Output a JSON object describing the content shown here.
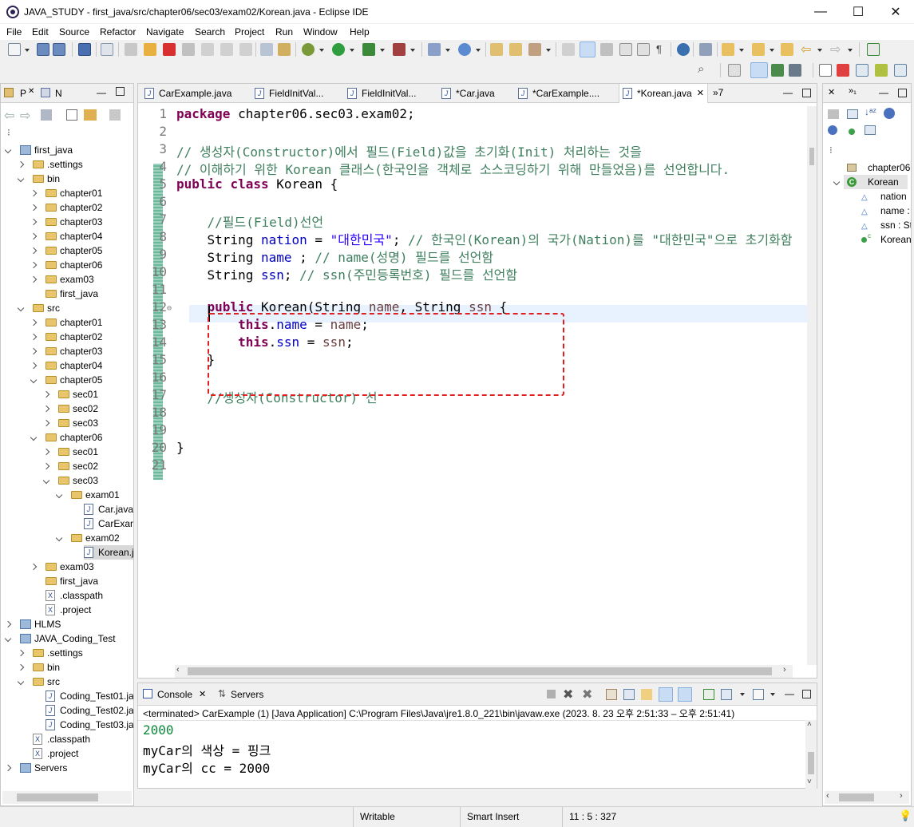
{
  "window": {
    "title": "JAVA_STUDY - first_java/src/chapter06/sec03/exam02/Korean.java - Eclipse IDE",
    "minimize": "—",
    "maximize": "☐",
    "close": "✕"
  },
  "menu": [
    "File",
    "Edit",
    "Source",
    "Refactor",
    "Navigate",
    "Search",
    "Project",
    "Run",
    "Window",
    "Help"
  ],
  "package_explorer": {
    "tab1": "P",
    "tab2": "N",
    "tree": [
      {
        "label": "first_java",
        "level": 0,
        "kind": "project",
        "open": true
      },
      {
        "label": ".settings",
        "level": 1,
        "kind": "folder",
        "open": false
      },
      {
        "label": "bin",
        "level": 1,
        "kind": "folder",
        "open": true
      },
      {
        "label": "chapter01",
        "level": 2,
        "kind": "folder",
        "open": false
      },
      {
        "label": "chapter02",
        "level": 2,
        "kind": "folder",
        "open": false
      },
      {
        "label": "chapter03",
        "level": 2,
        "kind": "folder",
        "open": false
      },
      {
        "label": "chapter04",
        "level": 2,
        "kind": "folder",
        "open": false
      },
      {
        "label": "chapter05",
        "level": 2,
        "kind": "folder",
        "open": false
      },
      {
        "label": "chapter06",
        "level": 2,
        "kind": "folder",
        "open": false
      },
      {
        "label": "exam03",
        "level": 2,
        "kind": "folder",
        "open": false
      },
      {
        "label": "first_java",
        "level": 2,
        "kind": "folder",
        "open": null
      },
      {
        "label": "src",
        "level": 1,
        "kind": "folder",
        "open": true
      },
      {
        "label": "chapter01",
        "level": 2,
        "kind": "folder",
        "open": false
      },
      {
        "label": "chapter02",
        "level": 2,
        "kind": "folder",
        "open": false
      },
      {
        "label": "chapter03",
        "level": 2,
        "kind": "folder",
        "open": false
      },
      {
        "label": "chapter04",
        "level": 2,
        "kind": "folder",
        "open": false
      },
      {
        "label": "chapter05",
        "level": 2,
        "kind": "folder",
        "open": true
      },
      {
        "label": "sec01",
        "level": 3,
        "kind": "folder",
        "open": false
      },
      {
        "label": "sec02",
        "level": 3,
        "kind": "folder",
        "open": false
      },
      {
        "label": "sec03",
        "level": 3,
        "kind": "folder",
        "open": false
      },
      {
        "label": "chapter06",
        "level": 2,
        "kind": "folder",
        "open": true
      },
      {
        "label": "sec01",
        "level": 3,
        "kind": "folder",
        "open": false
      },
      {
        "label": "sec02",
        "level": 3,
        "kind": "folder",
        "open": false
      },
      {
        "label": "sec03",
        "level": 3,
        "kind": "folder",
        "open": true
      },
      {
        "label": "exam01",
        "level": 4,
        "kind": "folder",
        "open": true
      },
      {
        "label": "Car.java",
        "level": 5,
        "kind": "java",
        "open": null
      },
      {
        "label": "CarExan",
        "level": 5,
        "kind": "java",
        "open": null
      },
      {
        "label": "exam02",
        "level": 4,
        "kind": "folder",
        "open": true
      },
      {
        "label": "Korean.j",
        "level": 5,
        "kind": "java",
        "open": null,
        "selected": true
      },
      {
        "label": "exam03",
        "level": 2,
        "kind": "folder",
        "open": false
      },
      {
        "label": "first_java",
        "level": 2,
        "kind": "folder",
        "open": null
      },
      {
        "label": ".classpath",
        "level": 2,
        "kind": "xml",
        "open": null
      },
      {
        "label": ".project",
        "level": 2,
        "kind": "xml",
        "open": null
      },
      {
        "label": "HLMS",
        "level": 0,
        "kind": "project",
        "open": false
      },
      {
        "label": "JAVA_Coding_Test",
        "level": 0,
        "kind": "project",
        "open": true
      },
      {
        "label": ".settings",
        "level": 1,
        "kind": "folder",
        "open": false
      },
      {
        "label": "bin",
        "level": 1,
        "kind": "folder",
        "open": false
      },
      {
        "label": "src",
        "level": 1,
        "kind": "folder",
        "open": true
      },
      {
        "label": "Coding_Test01.ja",
        "level": 2,
        "kind": "java",
        "open": null
      },
      {
        "label": "Coding_Test02.ja",
        "level": 2,
        "kind": "java",
        "open": null
      },
      {
        "label": "Coding_Test03.ja",
        "level": 2,
        "kind": "java",
        "open": null
      },
      {
        "label": ".classpath",
        "level": 1,
        "kind": "xml",
        "open": null
      },
      {
        "label": ".project",
        "level": 1,
        "kind": "xml",
        "open": null
      },
      {
        "label": "Servers",
        "level": 0,
        "kind": "project",
        "open": false
      }
    ]
  },
  "editor": {
    "tabs": [
      {
        "label": "CarExample.java",
        "active": false
      },
      {
        "label": "FieldInitVal...",
        "active": false
      },
      {
        "label": "FieldInitVal...",
        "active": false
      },
      {
        "label": "*Car.java",
        "active": false
      },
      {
        "label": "*CarExample....",
        "active": false
      },
      {
        "label": "*Korean.java",
        "active": true
      }
    ],
    "overflow": "»7",
    "lines": [
      {
        "n": "1",
        "parts": [
          [
            "kw",
            "package"
          ],
          [
            "",
            " chapter06.sec03.exam02;"
          ]
        ]
      },
      {
        "n": "2",
        "parts": []
      },
      {
        "n": "3",
        "parts": [
          [
            "cm",
            "// 생성자(Constructor)에서 필드(Field)값을 초기화(Init) 처리하는 것을"
          ]
        ]
      },
      {
        "n": "4",
        "parts": [
          [
            "cm",
            "// 이해하기 위한 Korean 클래스(한국인을 객체로 소스코딩하기 위해 만들었음)를 선언합니다."
          ]
        ]
      },
      {
        "n": "5",
        "parts": [
          [
            "kw",
            "public"
          ],
          [
            "",
            " "
          ],
          [
            "kw",
            "class"
          ],
          [
            "",
            " Korean {"
          ]
        ]
      },
      {
        "n": "6",
        "parts": []
      },
      {
        "n": "7",
        "parts": [
          [
            "",
            "    "
          ],
          [
            "cm",
            "//필드(Field)선언"
          ]
        ]
      },
      {
        "n": "8",
        "parts": [
          [
            "",
            "    String "
          ],
          [
            "fd",
            "nation"
          ],
          [
            "",
            " = "
          ],
          [
            "st",
            "\"대한민국\""
          ],
          [
            "",
            "; "
          ],
          [
            "cm",
            "// 한국인(Korean)의 국가(Nation)를 \"대한민국\"으로 초기화함"
          ]
        ]
      },
      {
        "n": "9",
        "parts": [
          [
            "",
            "    String "
          ],
          [
            "fd",
            "name"
          ],
          [
            "",
            " ; "
          ],
          [
            "cm",
            "// name(성명) 필드를 선언함"
          ]
        ]
      },
      {
        "n": "10",
        "parts": [
          [
            "",
            "    String "
          ],
          [
            "fd",
            "ssn"
          ],
          [
            "",
            "; "
          ],
          [
            "cm",
            "// ssn(주민등록번호) 필드를 선언함"
          ]
        ]
      },
      {
        "n": "11",
        "parts": [
          [
            "",
            "    "
          ]
        ]
      },
      {
        "n": "12",
        "parts": [
          [
            "",
            "    "
          ],
          [
            "kw",
            "public"
          ],
          [
            "",
            " Korean(String "
          ],
          [
            "ov",
            "name"
          ],
          [
            "",
            ", String "
          ],
          [
            "ov",
            "ssn"
          ],
          [
            "",
            " {"
          ]
        ]
      },
      {
        "n": "13",
        "parts": [
          [
            "",
            "        "
          ],
          [
            "kw",
            "this"
          ],
          [
            "",
            "."
          ],
          [
            "fd",
            "name"
          ],
          [
            "",
            " = "
          ],
          [
            "ov",
            "name"
          ],
          [
            "",
            ";"
          ]
        ]
      },
      {
        "n": "14",
        "parts": [
          [
            "",
            "        "
          ],
          [
            "kw",
            "this"
          ],
          [
            "",
            "."
          ],
          [
            "fd",
            "ssn"
          ],
          [
            "",
            " = "
          ],
          [
            "ov",
            "ssn"
          ],
          [
            "",
            ";"
          ]
        ]
      },
      {
        "n": "15",
        "parts": [
          [
            "",
            "    }"
          ]
        ]
      },
      {
        "n": "16",
        "parts": []
      },
      {
        "n": "17",
        "parts": [
          [
            "",
            "    "
          ],
          [
            "cm",
            "//생성자(Constructor) 선"
          ]
        ]
      },
      {
        "n": "18",
        "parts": []
      },
      {
        "n": "19",
        "parts": []
      },
      {
        "n": "20",
        "parts": [
          [
            "",
            "}"
          ]
        ]
      },
      {
        "n": "21",
        "parts": []
      }
    ]
  },
  "console": {
    "tab_console": "Console",
    "tab_servers": "Servers",
    "terminated": "<terminated> CarExample (1) [Java Application] C:\\Program Files\\Java\\jre1.8.0_221\\bin\\javaw.exe  (2023. 8. 23 오후 2:51:33 – 오후 2:51:41)",
    "output": [
      "2000",
      "myCar의 색상 = 핑크",
      "myCar의 cc = 2000"
    ]
  },
  "outline": {
    "items": [
      {
        "label": "chapter06",
        "kind": "package"
      },
      {
        "label": "Korean",
        "kind": "class"
      },
      {
        "label": "nation",
        "kind": "field"
      },
      {
        "label": "name :",
        "kind": "field"
      },
      {
        "label": "ssn : St",
        "kind": "field"
      },
      {
        "label": "Korean",
        "kind": "constructor"
      }
    ]
  },
  "statusbar": {
    "writable": "Writable",
    "insert_mode": "Smart Insert",
    "position": "11 : 5 : 327"
  },
  "colors": {
    "keyword": "#7f0055",
    "comment": "#3f7f5f",
    "string": "#2a00ff",
    "field": "#0000c0",
    "annotation_box": "#e02020",
    "console_number": "#0a8a3a"
  }
}
